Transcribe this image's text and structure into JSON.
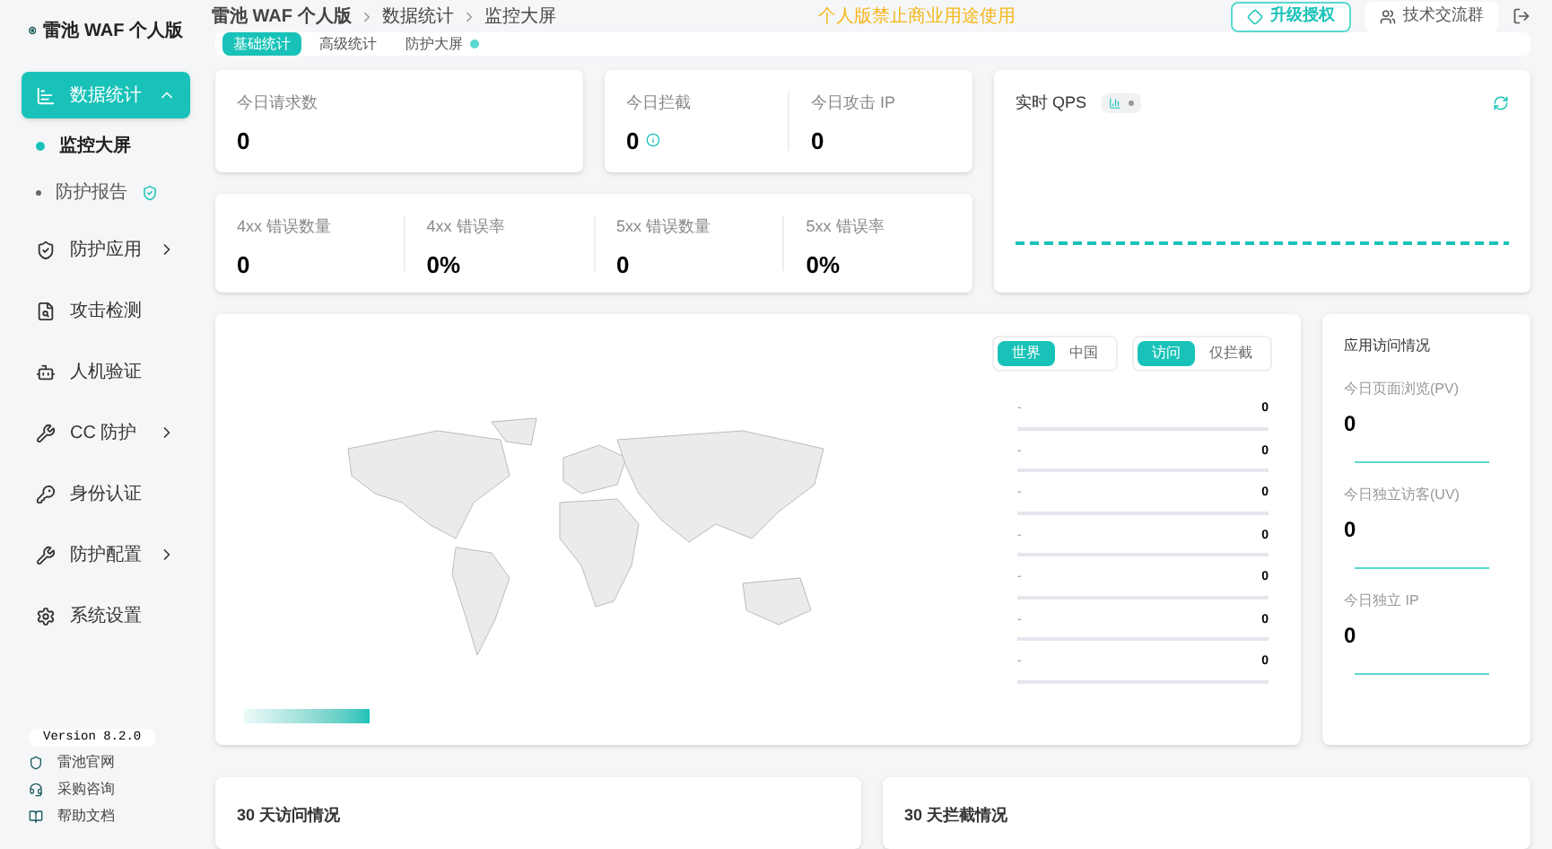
{
  "brand": {
    "name": "雷池 WAF 个人版"
  },
  "breadcrumb": [
    "雷池 WAF 个人版",
    "数据统计",
    "监控大屏"
  ],
  "notice": "个人版禁止商业用途使用",
  "header_actions": {
    "upgrade": "升级授权",
    "community": "技术交流群"
  },
  "sidebar": {
    "items": [
      {
        "label": "数据统计",
        "kind": "group",
        "expanded": true,
        "selected": true,
        "children": [
          {
            "label": "监控大屏",
            "selected": true,
            "badge": false
          },
          {
            "label": "防护报告",
            "selected": false,
            "badge": true
          }
        ]
      },
      {
        "label": "防护应用",
        "kind": "group",
        "expanded": false,
        "selected": false
      },
      {
        "label": "攻击检测",
        "kind": "link",
        "selected": false
      },
      {
        "label": "人机验证",
        "kind": "link",
        "selected": false
      },
      {
        "label": "CC 防护",
        "kind": "group",
        "expanded": false,
        "selected": false
      },
      {
        "label": "身份认证",
        "kind": "link",
        "selected": false
      },
      {
        "label": "防护配置",
        "kind": "group",
        "expanded": false,
        "selected": false
      },
      {
        "label": "系统设置",
        "kind": "link",
        "selected": false
      }
    ],
    "version": "Version 8.2.0",
    "links": [
      "雷池官网",
      "采购咨询",
      "帮助文档"
    ]
  },
  "tabs": [
    {
      "label": "基础统计",
      "selected": true
    },
    {
      "label": "高级统计",
      "selected": false
    },
    {
      "label": "防护大屏",
      "selected": false
    }
  ],
  "stats_row1": [
    {
      "label": "今日请求数",
      "value": "0"
    },
    {
      "label": "今日拦截",
      "value": "0"
    },
    {
      "label": "今日攻击 IP",
      "value": "0"
    }
  ],
  "stats_row2": [
    {
      "label": "4xx 错误数量",
      "value": "0"
    },
    {
      "label": "4xx 错误率",
      "value": "0%"
    },
    {
      "label": "5xx 错误数量",
      "value": "0"
    },
    {
      "label": "5xx 错误率",
      "value": "0%"
    }
  ],
  "qps": {
    "title": "实时 QPS",
    "bar_mode": true
  },
  "map": {
    "region_toggle": [
      {
        "label": "世界",
        "selected": true
      },
      {
        "label": "中国",
        "selected": false
      }
    ],
    "mode_toggle": [
      {
        "label": "访问",
        "selected": true
      },
      {
        "label": "仅拦截",
        "selected": false
      }
    ],
    "ranking": [
      {
        "name": "-",
        "value": "0"
      },
      {
        "name": "-",
        "value": "0"
      },
      {
        "name": "-",
        "value": "0"
      },
      {
        "name": "-",
        "value": "0"
      },
      {
        "name": "-",
        "value": "0"
      },
      {
        "name": "-",
        "value": "0"
      },
      {
        "name": "-",
        "value": "0"
      }
    ]
  },
  "app_access": {
    "title": "应用访问情况",
    "items": [
      {
        "label": "今日页面浏览(PV)",
        "value": "0"
      },
      {
        "label": "今日独立访客(UV)",
        "value": "0"
      },
      {
        "label": "今日独立 IP",
        "value": "0"
      }
    ]
  },
  "bottom_cards": [
    "30 天访问情况",
    "30 天拦截情况"
  ]
}
